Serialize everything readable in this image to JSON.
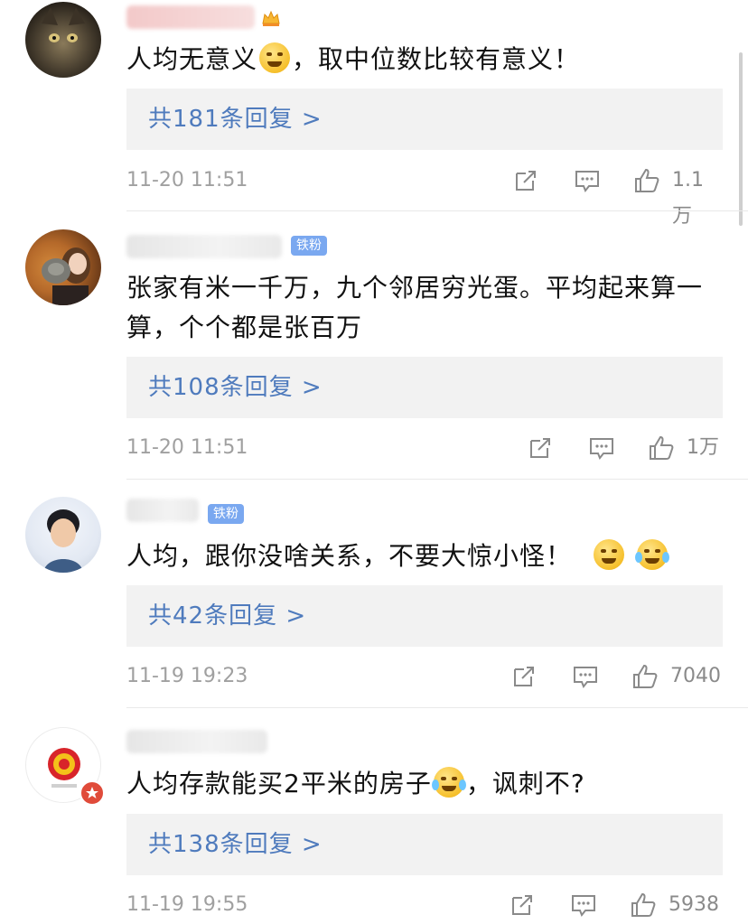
{
  "comments": [
    {
      "text_before": "人均无意义",
      "text_after": "，取中位数比较有意义！",
      "reply_label": "共181条回复 >",
      "time": "11-20 11:51",
      "likes": "1.1万"
    },
    {
      "badge": "铁粉",
      "text": "张家有米一千万，九个邻居穷光蛋。平均起来算一算，个个都是张百万",
      "reply_label": "共108条回复 >",
      "time": "11-20 11:51",
      "likes": "1万"
    },
    {
      "badge": "铁粉",
      "text": "人均，跟你没啥关系，不要大惊小怪！",
      "reply_label": "共42条回复 >",
      "time": "11-19 19:23",
      "likes": "7040"
    },
    {
      "text_before": "人均存款能买2平米的房子",
      "text_after": "，讽刺不?",
      "reply_label": "共138条回复 >",
      "time": "11-19 19:55",
      "likes": "5938"
    }
  ],
  "icons": {
    "share": "share-icon",
    "comment": "comment-icon",
    "like": "thumbs-up-icon"
  },
  "colors": {
    "link": "#4f7bbd",
    "badge": "#7aa8f0",
    "reply_bg": "#f2f2f2"
  }
}
